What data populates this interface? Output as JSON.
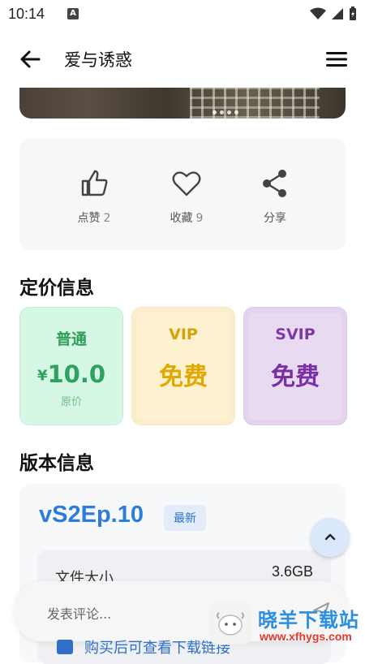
{
  "status": {
    "time": "10:14",
    "app_badge": "A"
  },
  "appbar": {
    "title": "爱与诱惑"
  },
  "actions": [
    {
      "icon": "thumb-up-icon",
      "label": "点赞",
      "count": "2"
    },
    {
      "icon": "heart-icon",
      "label": "收藏",
      "count": "9"
    },
    {
      "icon": "share-icon",
      "label": "分享",
      "count": ""
    }
  ],
  "pricing": {
    "heading": "定价信息",
    "normal": {
      "name": "普通",
      "currency": "¥",
      "value": "10.0",
      "note": "原价"
    },
    "vip": {
      "name": "VIP",
      "value": "免费"
    },
    "svip": {
      "name": "SVIP",
      "value": "免费"
    }
  },
  "version": {
    "heading": "版本信息",
    "name": "vS2Ep.10",
    "badge": "最新",
    "file_size_label": "文件大小",
    "file_size": "3.6GB"
  },
  "comment": {
    "placeholder": "发表评论..."
  },
  "notice": {
    "text": "购买后可查看下载链接"
  },
  "watermark": {
    "brand": "晓羊下载站",
    "url": "www.xfhygs.com"
  },
  "colors": {
    "accent": "#2f7bd9",
    "normal": "#2fa262",
    "vip": "#e0a800",
    "svip": "#7a2fa5"
  }
}
